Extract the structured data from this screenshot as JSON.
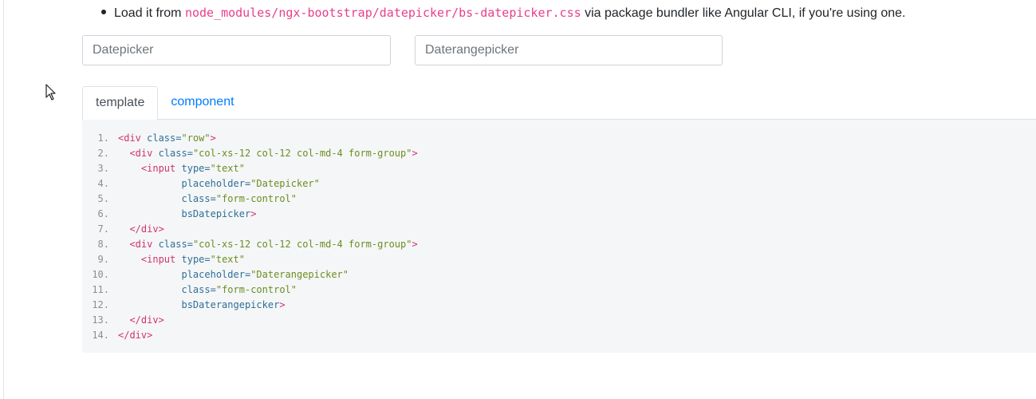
{
  "intro": {
    "prefix": "Load it from ",
    "code": "node_modules/ngx-bootstrap/datepicker/bs-datepicker.css",
    "suffix": " via package bundler like Angular CLI, if you're using one."
  },
  "inputs": {
    "datepicker_placeholder": "Datepicker",
    "daterangepicker_placeholder": "Daterangepicker"
  },
  "tabs": [
    {
      "label": "template",
      "active": true
    },
    {
      "label": "component",
      "active": false
    }
  ],
  "code_lines": [
    {
      "n": "1.",
      "tokens": [
        [
          "tag",
          "<div"
        ],
        [
          "attr",
          " class="
        ],
        [
          "str",
          "\"row\""
        ],
        [
          "tag",
          ">"
        ]
      ]
    },
    {
      "n": "2.",
      "tokens": [
        [
          "plain",
          "  "
        ],
        [
          "tag",
          "<div"
        ],
        [
          "attr",
          " class="
        ],
        [
          "str",
          "\"col-xs-12 col-12 col-md-4 form-group\""
        ],
        [
          "tag",
          ">"
        ]
      ]
    },
    {
      "n": "3.",
      "tokens": [
        [
          "plain",
          "    "
        ],
        [
          "tag",
          "<input"
        ],
        [
          "attr",
          " type="
        ],
        [
          "str",
          "\"text\""
        ]
      ]
    },
    {
      "n": "4.",
      "tokens": [
        [
          "plain",
          "           "
        ],
        [
          "attr",
          "placeholder="
        ],
        [
          "str",
          "\"Datepicker\""
        ]
      ]
    },
    {
      "n": "5.",
      "tokens": [
        [
          "plain",
          "           "
        ],
        [
          "attr",
          "class="
        ],
        [
          "str",
          "\"form-control\""
        ]
      ]
    },
    {
      "n": "6.",
      "tokens": [
        [
          "plain",
          "           "
        ],
        [
          "attr",
          "bsDatepicker"
        ],
        [
          "tag",
          ">"
        ]
      ]
    },
    {
      "n": "7.",
      "tokens": [
        [
          "plain",
          "  "
        ],
        [
          "tag",
          "</div>"
        ]
      ]
    },
    {
      "n": "8.",
      "tokens": [
        [
          "plain",
          "  "
        ],
        [
          "tag",
          "<div"
        ],
        [
          "attr",
          " class="
        ],
        [
          "str",
          "\"col-xs-12 col-12 col-md-4 form-group\""
        ],
        [
          "tag",
          ">"
        ]
      ]
    },
    {
      "n": "9.",
      "tokens": [
        [
          "plain",
          "    "
        ],
        [
          "tag",
          "<input"
        ],
        [
          "attr",
          " type="
        ],
        [
          "str",
          "\"text\""
        ]
      ]
    },
    {
      "n": "10.",
      "tokens": [
        [
          "plain",
          "           "
        ],
        [
          "attr",
          "placeholder="
        ],
        [
          "str",
          "\"Daterangepicker\""
        ]
      ]
    },
    {
      "n": "11.",
      "tokens": [
        [
          "plain",
          "           "
        ],
        [
          "attr",
          "class="
        ],
        [
          "str",
          "\"form-control\""
        ]
      ]
    },
    {
      "n": "12.",
      "tokens": [
        [
          "plain",
          "           "
        ],
        [
          "attr",
          "bsDaterangepicker"
        ],
        [
          "tag",
          ">"
        ]
      ]
    },
    {
      "n": "13.",
      "tokens": [
        [
          "plain",
          "  "
        ],
        [
          "tag",
          "</div>"
        ]
      ]
    },
    {
      "n": "14.",
      "tokens": [
        [
          "tag",
          "</div>"
        ]
      ]
    }
  ],
  "colors": {
    "tab_link": "#007bff",
    "inline_code": "#e83e8c",
    "code_bg": "#f5f6f7"
  }
}
